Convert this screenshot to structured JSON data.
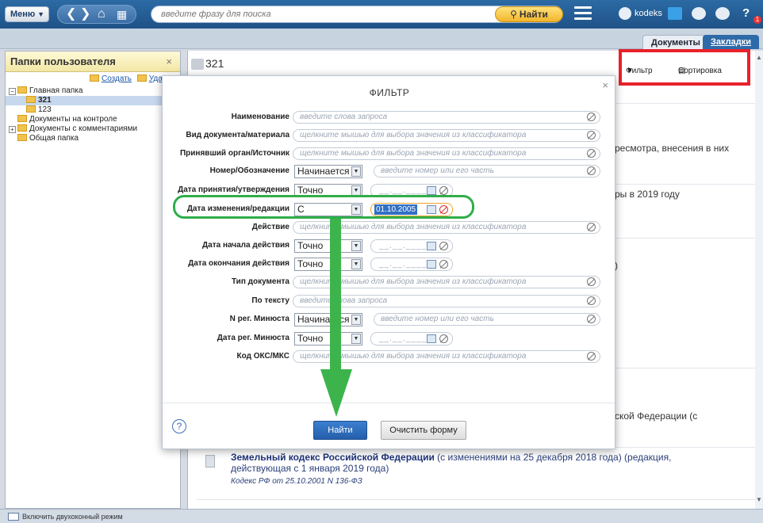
{
  "topbar": {
    "menu_label": "Меню",
    "search_placeholder": "введите фразу для поиска",
    "find_label": "Найти",
    "user_name": "kodeks",
    "notify_count": "1"
  },
  "tabs": {
    "documents": "Документы",
    "bookmarks": "Закладки"
  },
  "left_panel": {
    "title": "Папки пользователя",
    "create_label": "Создать",
    "delete_label": "Удал",
    "tree": [
      {
        "label": "Главная папка",
        "level": 0,
        "expand": "−",
        "selected": false
      },
      {
        "label": "321",
        "level": 1,
        "expand": "",
        "selected": true
      },
      {
        "label": "123",
        "level": 1,
        "expand": "",
        "selected": false
      },
      {
        "label": "Документы на контроле",
        "level": 0,
        "expand": "",
        "selected": false
      },
      {
        "label": "Документы с комментариями",
        "level": 0,
        "expand": "+",
        "selected": false
      },
      {
        "label": "Общая папка",
        "level": 0,
        "expand": "",
        "selected": false
      }
    ]
  },
  "main": {
    "title": "321",
    "filter_label": "Фильтр",
    "sort_label": "Сортировка",
    "bg_snippets": {
      "s1": "ресмотра, внесения в них",
      "s2": "ры в 2019 году",
      "s3": ")",
      "s4": "ской Федерации (с"
    },
    "doc": {
      "title_bold": "Земельный кодекс Российской Федерации",
      "title_rest": " (с изменениями на 25 декабря 2018 года) (редакция, действующая с 1 января 2019 года)",
      "subtitle": "Кодекс РФ от 25.10.2001 N 136-ФЗ"
    }
  },
  "filter_modal": {
    "title": "ФИЛЬТР",
    "fields": {
      "name": {
        "label": "Наименование",
        "placeholder": "введите слова запроса"
      },
      "doc_kind": {
        "label": "Вид документа/материала",
        "placeholder": "щелкните мышью для выбора значения из классификатора"
      },
      "issuer": {
        "label": "Принявший орган/Источник",
        "placeholder": "щелкните мышью для выбора значения из классификатора"
      },
      "number": {
        "label": "Номер/Обозначение",
        "mode": "Начинается с",
        "placeholder": "введите номер или его часть"
      },
      "adopt_date": {
        "label": "Дата принятия/утверждения",
        "mode": "Точно",
        "mask": "__.__.____"
      },
      "edit_date": {
        "label": "Дата изменения/редакции",
        "mode": "С",
        "value": "01.10.2005"
      },
      "action": {
        "label": "Действие",
        "placeholder": "щелкните мышью для выбора значения из классификатора"
      },
      "start_date": {
        "label": "Дата начала действия",
        "mode": "Точно",
        "mask": "__.__.____"
      },
      "end_date": {
        "label": "Дата окончания действия",
        "mode": "Точно",
        "mask": "__.__.____"
      },
      "doc_type": {
        "label": "Тип документа",
        "placeholder": "щелкните мышью для выбора значения из классификатора"
      },
      "by_text": {
        "label": "По тексту",
        "placeholder": "введите слова запроса"
      },
      "minjust_no": {
        "label": "N рег. Минюста",
        "mode": "Начинается с",
        "placeholder": "введите номер или его часть"
      },
      "minjust_date": {
        "label": "Дата рег. Минюста",
        "mode": "Точно",
        "mask": "__.__.____"
      },
      "oks": {
        "label": "Код ОКС/МКС",
        "placeholder": "щелкните мышью для выбора значения из классификатора"
      }
    },
    "find_button": "Найти",
    "clear_button": "Очистить форму"
  },
  "status": {
    "two_window_label": "Включить двухоконный режим"
  },
  "colors": {
    "highlight_box": "#e8212a",
    "annotation_green": "#3cb44b",
    "primary_blue": "#255fab"
  }
}
